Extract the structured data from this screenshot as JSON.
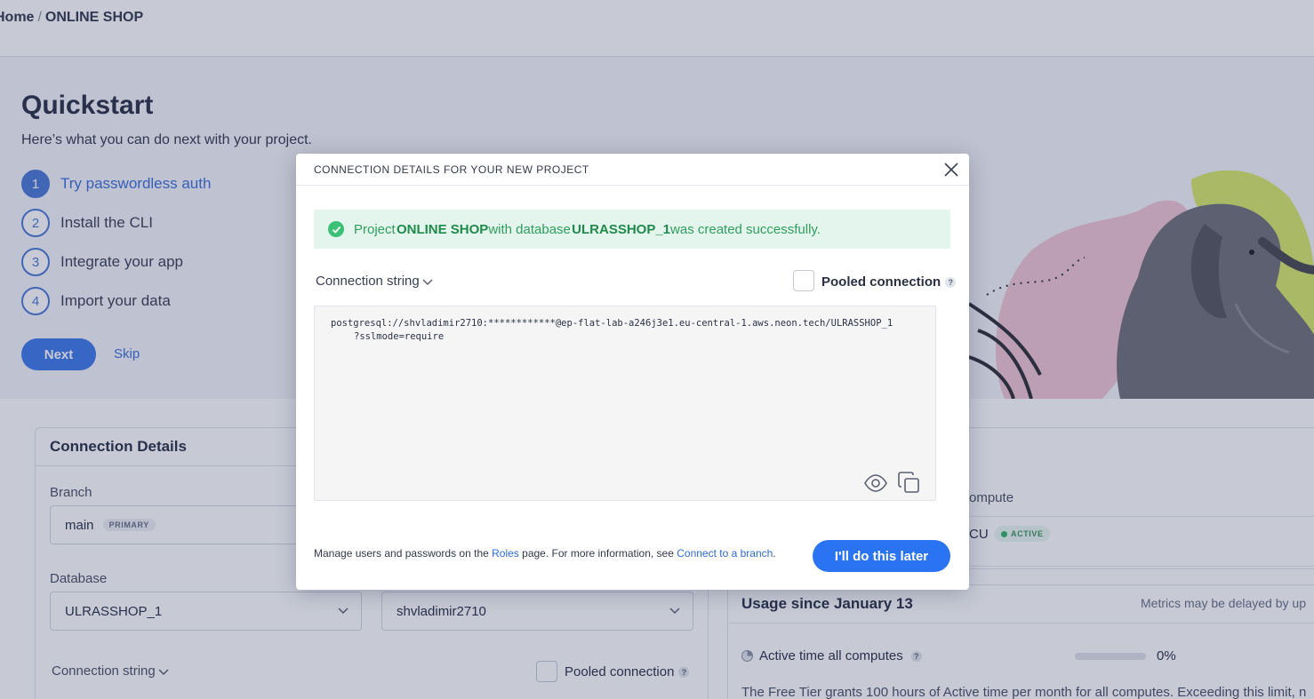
{
  "breadcrumb": {
    "home": "Home",
    "separator": "/",
    "project": "ONLINE SHOP"
  },
  "quickstart": {
    "title": "Quickstart",
    "subtitle": "Here’s what you can do next with your project.",
    "steps": [
      {
        "num": "1",
        "label": "Try passwordless auth",
        "active": true
      },
      {
        "num": "2",
        "label": "Install the CLI",
        "active": false
      },
      {
        "num": "3",
        "label": "Integrate your app",
        "active": false
      },
      {
        "num": "4",
        "label": "Import your data",
        "active": false
      }
    ],
    "next_label": "Next",
    "skip_label": "Skip"
  },
  "connection_panel": {
    "title": "Connection Details",
    "branch_label": "Branch",
    "branch_value": "main",
    "branch_badge": "PRIMARY",
    "database_label": "Database",
    "database_value": "ULRASSHOP_1",
    "role_value": "shvladimir2710",
    "connection_string_label": "Connection string",
    "pooled_label": "Pooled connection",
    "help_icon_text": "?"
  },
  "compute_panel": {
    "compute_label": "ompute",
    "cu_text": "CU",
    "status_badge": "ACTIVE"
  },
  "usage": {
    "title": "Usage since January 13",
    "note": "Metrics may be delayed by up",
    "active_time_label": "Active time all computes",
    "active_time_percent": "0%",
    "active_time_fraction": 0,
    "free_tier_text": "The Free Tier grants 100 hours of Active time per month for all computes. Exceeding this limit, n"
  },
  "modal": {
    "title": "CONNECTION DETAILS FOR YOUR NEW PROJECT",
    "success": {
      "prefix": "Project ",
      "project": "ONLINE SHOP",
      "middle": " with database ",
      "database": "ULRASSHOP_1",
      "suffix": " was created successfully."
    },
    "connection_string_label": "Connection string",
    "pooled_label": "Pooled connection",
    "connection_string_line1": "postgresql://shvladimir2710:************@ep-flat-lab-a246j3e1.eu-central-1.aws.neon.tech/ULRASSHOP_1",
    "connection_string_line2": "?sslmode=require",
    "footer": {
      "part1": "Manage users and passwords on the ",
      "roles_link": "Roles",
      "part2": " page. For more information, see ",
      "connect_link": "Connect to a branch",
      "part3": "."
    },
    "later_button": "I'll do this later"
  },
  "icons": {
    "close": "close-icon",
    "eye": "eye-icon",
    "copy": "copy-icon",
    "check": "check-circle-icon",
    "chevron": "chevron-down-icon",
    "help": "help-icon",
    "pie": "pie-chart-icon"
  },
  "colors": {
    "accent": "#2a73f2",
    "success_bg": "#e3f5ec",
    "success_text": "#2f9e5e",
    "overlay": "rgba(40, 52, 92, 0.26)",
    "page_bg": "#f4f5f9"
  }
}
